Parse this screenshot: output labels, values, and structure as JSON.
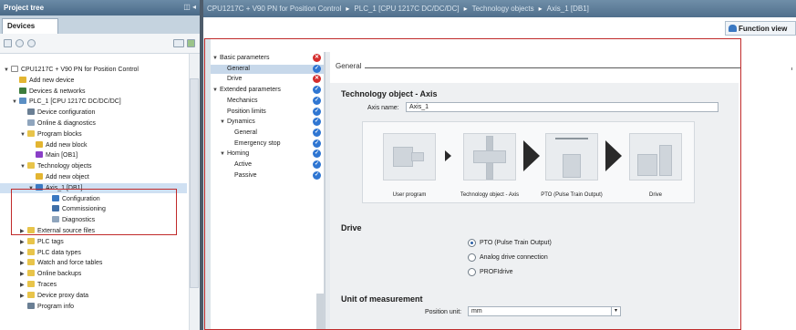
{
  "left": {
    "title": "Project tree",
    "header_icons": "◫ ◂",
    "tab": "Devices",
    "tree": [
      {
        "label": "CPU1217C + V90 PN for Position Control",
        "level": 0,
        "tri": "▼",
        "color": "#ffffff"
      },
      {
        "label": "Add new device",
        "level": 1,
        "tri": "",
        "color": "#e3b531"
      },
      {
        "label": "Devices & networks",
        "level": 1,
        "tri": "",
        "color": "#3c7c3c"
      },
      {
        "label": "PLC_1 [CPU 1217C DC/DC/DC]",
        "level": 1,
        "tri": "▼",
        "color": "#5b8fc4"
      },
      {
        "label": "Device configuration",
        "level": 2,
        "tri": "",
        "color": "#6a7f94"
      },
      {
        "label": "Online & diagnostics",
        "level": 2,
        "tri": "",
        "color": "#8fa5bd"
      },
      {
        "label": "Program blocks",
        "level": 2,
        "tri": "▼",
        "color": "#e8c44a"
      },
      {
        "label": "Add new block",
        "level": 3,
        "tri": "",
        "color": "#e3b531"
      },
      {
        "label": "Main [OB1]",
        "level": 3,
        "tri": "",
        "color": "#8a3fc7"
      },
      {
        "label": "Technology objects",
        "level": 2,
        "tri": "▼",
        "color": "#e8c44a"
      },
      {
        "label": "Add new object",
        "level": 3,
        "tri": "",
        "color": "#e3b531"
      },
      {
        "label": "Axis_1 [DB1]",
        "level": 3,
        "tri": "▼",
        "color": "#3a78c2"
      },
      {
        "label": "Configuration",
        "level": 5,
        "tri": "",
        "color": "#3a78c2"
      },
      {
        "label": "Commissioning",
        "level": 5,
        "tri": "",
        "color": "#3f6fa8"
      },
      {
        "label": "Diagnostics",
        "level": 5,
        "tri": "",
        "color": "#8fa5bd"
      },
      {
        "label": "External source files",
        "level": 2,
        "tri": "▶",
        "color": "#e8c44a"
      },
      {
        "label": "PLC tags",
        "level": 2,
        "tri": "▶",
        "color": "#e8c44a"
      },
      {
        "label": "PLC data types",
        "level": 2,
        "tri": "▶",
        "color": "#e8c44a"
      },
      {
        "label": "Watch and force tables",
        "level": 2,
        "tri": "▶",
        "color": "#e8c44a"
      },
      {
        "label": "Online backups",
        "level": 2,
        "tri": "▶",
        "color": "#e8c44a"
      },
      {
        "label": "Traces",
        "level": 2,
        "tri": "▶",
        "color": "#e8c44a"
      },
      {
        "label": "Device proxy data",
        "level": 2,
        "tri": "▶",
        "color": "#e8c44a"
      },
      {
        "label": "Program info",
        "level": 2,
        "tri": "",
        "color": "#6a7f94"
      }
    ]
  },
  "breadcrumb": [
    "CPU1217C + V90 PN for Position Control",
    "PLC_1 [CPU 1217C DC/DC/DC]",
    "Technology objects",
    "Axis_1 [DB1]"
  ],
  "function_view": "Function view",
  "nav": [
    {
      "label": "Basic parameters",
      "indent": 0,
      "tri": "▼",
      "status": "err"
    },
    {
      "label": "General",
      "indent": 2,
      "tri": "",
      "status": "ok",
      "selected": true
    },
    {
      "label": "Drive",
      "indent": 2,
      "tri": "",
      "status": "err"
    },
    {
      "label": "Extended parameters",
      "indent": 0,
      "tri": "▼",
      "status": "ok"
    },
    {
      "label": "Mechanics",
      "indent": 2,
      "tri": "",
      "status": "ok"
    },
    {
      "label": "Position limits",
      "indent": 2,
      "tri": "",
      "status": "ok"
    },
    {
      "label": "Dynamics",
      "indent": 1,
      "tri": "▼",
      "status": "ok"
    },
    {
      "label": "General",
      "indent": 3,
      "tri": "",
      "status": "ok"
    },
    {
      "label": "Emergency stop",
      "indent": 3,
      "tri": "",
      "status": "ok"
    },
    {
      "label": "Homing",
      "indent": 1,
      "tri": "▼",
      "status": "ok"
    },
    {
      "label": "Active",
      "indent": 3,
      "tri": "",
      "status": "ok"
    },
    {
      "label": "Passive",
      "indent": 3,
      "tri": "",
      "status": "ok"
    }
  ],
  "content": {
    "section_title": "General",
    "panel_title": "Technology object - Axis",
    "axis_name_label": "Axis name:",
    "axis_name_value": "Axis_1",
    "blocks": [
      "User program",
      "Technology object - Axis",
      "PTO (Pulse Train Output)",
      "Drive"
    ],
    "drive_heading": "Drive",
    "drive_options": [
      {
        "label": "PTO (Pulse Train Output)",
        "checked": true
      },
      {
        "label": "Analog drive connection",
        "checked": false
      },
      {
        "label": "PROFIdrive",
        "checked": false
      }
    ],
    "uom_heading": "Unit of measurement",
    "position_unit_label": "Position unit:",
    "position_unit_value": "mm"
  }
}
